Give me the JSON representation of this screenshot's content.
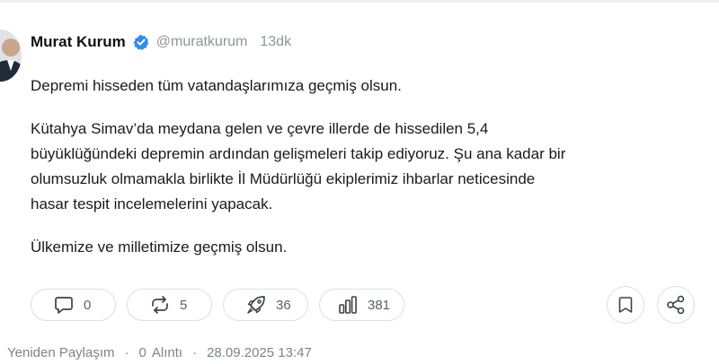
{
  "author": {
    "name": "Murat Kurum",
    "handle": "@muratkurum",
    "time": "13dk"
  },
  "post": {
    "paragraph_1": "Depremi hisseden tüm vatandaşlarımıza geçmiş olsun.",
    "paragraph_2_lines": [
      "Kütahya Simav’da meydana gelen ve çevre illerde de hissedilen 5,4",
      "büyüklüğündeki depremin ardından gelişmeleri takip ediyoruz. Şu ana kadar bir",
      "olumsuzluk olmamakla birlikte İl Müdürlüğü ekiplerimiz ihbarlar neticesinde",
      "hasar tespit incelemelerini yapacak."
    ],
    "paragraph_3": "Ülkemize ve milletimize geçmiş olsun."
  },
  "actions": {
    "replies": "0",
    "reposts": "5",
    "boosts": "36",
    "views": "381"
  },
  "meta": {
    "repost_label": "Yeniden Paylaşım",
    "quote_count": "0",
    "quote_label": "Alıntı",
    "timestamp": "28.09.2025 13:47"
  },
  "icons": {
    "verified": "verified-badge-icon",
    "reply": "comment-icon",
    "repost": "repost-icon",
    "boost": "rocket-icon",
    "views": "bar-chart-icon",
    "bookmark": "bookmark-icon",
    "share": "share-icon"
  },
  "colors": {
    "verified": "#2f8cf0",
    "text": "#1a1a1a",
    "muted": "#8e959c",
    "border": "#dcdfe3"
  }
}
